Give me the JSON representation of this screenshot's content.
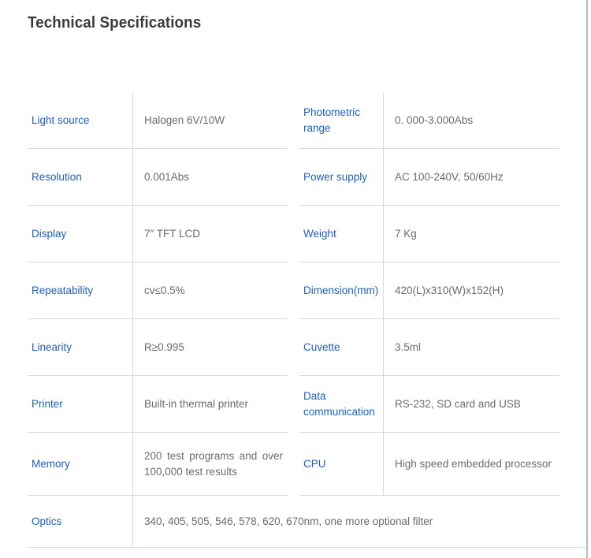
{
  "page": {
    "title": "Technical Specifications"
  },
  "colors": {
    "label": "#1f5fc0",
    "value": "#6b6b6b",
    "title": "#3a3a3a",
    "rule": "#d9d9d9",
    "edge_rule": "#a8c4b6"
  },
  "specs": {
    "left_column": [
      {
        "label": "Light source",
        "value": "Halogen 6V/10W"
      },
      {
        "label": "Resolution",
        "value": "0.001Abs"
      },
      {
        "label": "Display",
        "value": "7″ TFT LCD"
      },
      {
        "label": "Repeatability",
        "value": "cv≤0.5%"
      },
      {
        "label": "Linearity",
        "value": "R≥0.995"
      },
      {
        "label": "Printer",
        "value": "Built-in thermal printer"
      },
      {
        "label": "Memory",
        "value": "200 test programs and over 100,000 test results"
      }
    ],
    "right_column": [
      {
        "label": "Photometric range",
        "value": "0. 000-3.000Abs"
      },
      {
        "label": "Power supply",
        "value": "AC 100-240V, 50/60Hz"
      },
      {
        "label": "Weight",
        "value": "7 Kg"
      },
      {
        "label": "Dimension(mm)",
        "value": "420(L)x310(W)x152(H)"
      },
      {
        "label": "Cuvette",
        "value": "3.5ml"
      },
      {
        "label": "Data communication",
        "value": "RS-232, SD card and USB"
      },
      {
        "label": "CPU",
        "value": "High speed embedded processor"
      }
    ],
    "full_width_row": {
      "label": "Optics",
      "value": "340, 405, 505, 546, 578, 620, 670nm, one more optional filter"
    }
  }
}
